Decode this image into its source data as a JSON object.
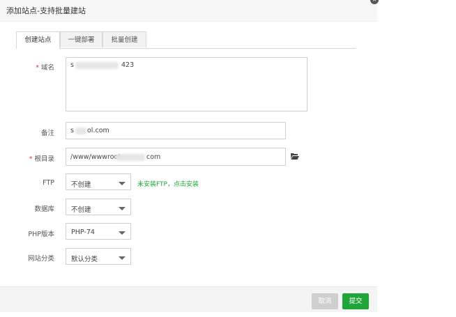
{
  "dialog": {
    "title": "添加站点-支持批量建站",
    "close_glyph": "×"
  },
  "tabs": [
    {
      "label": "创建站点",
      "active": true
    },
    {
      "label": "一键部署",
      "active": false
    },
    {
      "label": "批量创建",
      "active": false
    }
  ],
  "form": {
    "required_mark": "*",
    "domain": {
      "label": "域名",
      "value_start": "s",
      "value_end": "423"
    },
    "remark": {
      "label": "备注",
      "value_start": "s",
      "value_end": "ol.com"
    },
    "root": {
      "label": "根目录",
      "value_start": "/www/wwwroot",
      "value_end": "com"
    },
    "ftp": {
      "label": "FTP",
      "selected": "不创建",
      "note": "未安装FTP，点击安装"
    },
    "database": {
      "label": "数据库",
      "selected": "不创建"
    },
    "php": {
      "label": "PHP版本",
      "selected": "PHP-74"
    },
    "category": {
      "label": "网站分类",
      "selected": "默认分类"
    }
  },
  "footer": {
    "cancel_label": "取消",
    "submit_label": "提交"
  },
  "colors": {
    "accent_green": "#20a53a",
    "required_red": "#e2352f"
  },
  "icons": {
    "folder": "folder-open-icon",
    "caret": "caret-down-icon"
  }
}
